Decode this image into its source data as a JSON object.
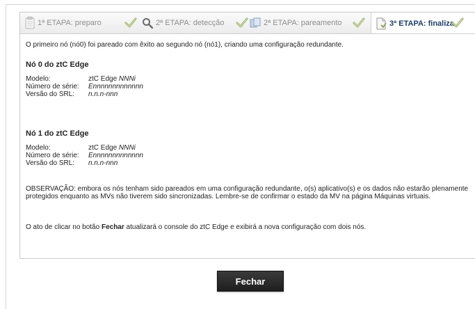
{
  "wizard": {
    "steps": [
      {
        "label": "1ª ETAPA: preparo",
        "icon": "clipboard-icon"
      },
      {
        "label": "2ª ETAPA: detecção",
        "icon": "magnifier-icon"
      },
      {
        "label": "2ª ETAPA: pareamento",
        "icon": "pairing-icon"
      },
      {
        "label": "3ª ETAPA: finaliza",
        "icon": "document-icon"
      }
    ],
    "completed_icon": "check-icon"
  },
  "content": {
    "intro": "O primeiro nó (nó0) foi pareado com êxito ao segundo nó (nó1), criando uma configuração redundante.",
    "node0": {
      "title": "Nó 0 do ztC Edge",
      "model_label": "Modelo:",
      "model_prefix": "ztC Edge ",
      "model_value": "NNNi",
      "serial_label": "Número de série:",
      "serial_value": "Ennnnnnnnnnnnn",
      "srl_label": "Versão do SRL:",
      "srl_value": "n.n.n-nnn"
    },
    "node1": {
      "title": "Nó 1 do ztC Edge",
      "model_label": "Modelo:",
      "model_prefix": "ztC Edge ",
      "model_value": "NNNi",
      "serial_label": "Número de série:",
      "serial_value": "Ennnnnnnnnnnnn",
      "srl_label": "Versão do SRL:",
      "srl_value": "n.n.n-nnn"
    },
    "note": "OBSERVAÇÃO: embora os nós tenham sido pareados em uma configuração redundante, o(s) aplicativo(s) e os dados não estarão plenamente protegidos enquanto as MVs não tiverem sido sincronizadas. Lembre-se de confirmar o estado da MV na página Máquinas virtuais.",
    "closing_prefix": "O ato de clicar no botão ",
    "closing_bold": "Fechar",
    "closing_suffix": " atualizará o console do ztC Edge e exibirá a nova configuração com dois nós."
  },
  "actions": {
    "close_label": "Fechar"
  }
}
